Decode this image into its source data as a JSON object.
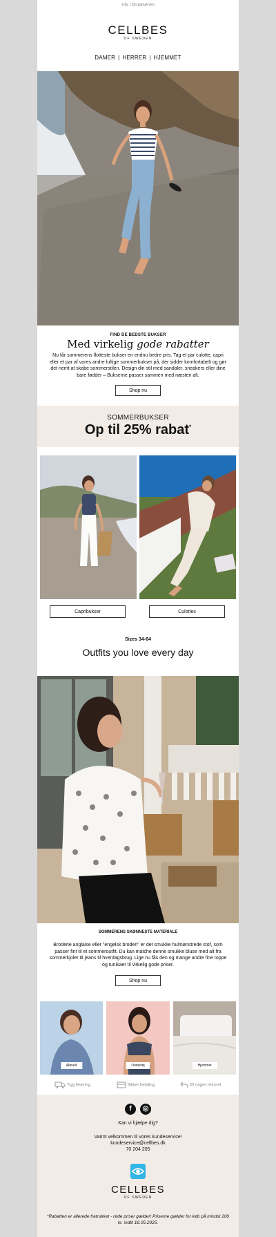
{
  "header": {
    "browser_link": "Vis i browseren",
    "brand": "CELLBES",
    "brand_sub": "OF SWEDEN",
    "nav": [
      "DAMER",
      "HERRER",
      "HJEMMET"
    ],
    "nav_sep": "|"
  },
  "section1": {
    "kicker": "FIND DE BEDSTE BUKSER",
    "title_plain": "Med virkelig ",
    "title_italic": "gode rabatter",
    "body": "Nu får sommerens flotteste bukser en endnu bedre pris. Tag et par culotte, capri eller et par af vores andre luftige sommerbukser på, der sidder komfortabelt og gør det nemt at skabe sommerstilen. Design din stil med sandaler, sneakers eller dine bare fødder – Bukserne passer sammen med næsten alt.",
    "button": "Shop nu"
  },
  "promo": {
    "kicker": "SOMMERBUKSER",
    "headline": "Op til 25% rabat",
    "mark": "*"
  },
  "categories": [
    {
      "label": "Capribukser"
    },
    {
      "label": "Culottes"
    }
  ],
  "section2": {
    "sizes": "Sizes 34-64",
    "headline": "Outfits you love every day"
  },
  "section3": {
    "kicker": "SOMMERENS SKØNNESTE MATERIALE",
    "body": "Broderie anglaise eller \"engelsk broderi\" er det smukke hulmønstrede stof, som passer fint til et sommeroutfit. Du kan matche denne smukke bluse med alt fra sommerkjoler til jeans til hverdagsbrug. Lige nu fås den og mange andre fine toppe og tunikaer til virkelig gode priser.",
    "button": "Shop nu"
  },
  "tiles": [
    {
      "label": "Aktuelt"
    },
    {
      "label": "Undertøj"
    },
    {
      "label": "Hjemmet"
    }
  ],
  "usps": [
    {
      "icon": "truck-icon",
      "label": "Tryg levering"
    },
    {
      "icon": "card-icon",
      "label": "Sikker betaling"
    },
    {
      "icon": "return-icon",
      "label": "30 dages returret"
    }
  ],
  "footer": {
    "help": "Kan vi hjælpe dig?",
    "welcome": "Varmt velkommen til vores kundeservice!",
    "email": "kundeservice@cellbes.dk",
    "phone": "70 204 205",
    "brand": "CELLBES",
    "brand_sub": "OF SWEDEN",
    "disclaimer": "*Rabatten er allerede fratrukket - røde priser gælder! Priserne gælder for køb på mindst 200 kr. indtil 18.05.2025."
  }
}
